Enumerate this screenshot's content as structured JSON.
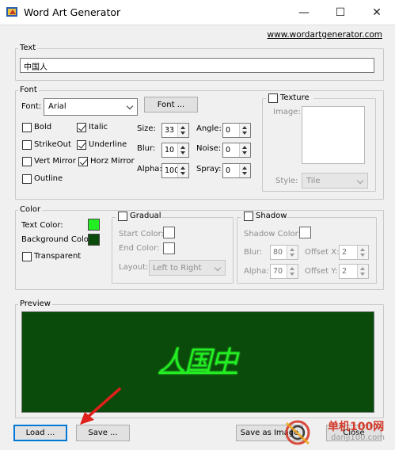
{
  "window": {
    "title": "Word Art Generator",
    "minimize_glyph": "—",
    "maximize_glyph": "☐",
    "close_glyph": "✕"
  },
  "website_link": "www.wordartgenerator.com",
  "text_group": {
    "label": "Text",
    "value": "中国人"
  },
  "font_group": {
    "label": "Font",
    "font_label": "Font:",
    "font_value": "Arial",
    "font_button": "Font ...",
    "checkboxes": {
      "bold": {
        "label": "Bold",
        "checked": false
      },
      "italic": {
        "label": "Italic",
        "checked": true
      },
      "strikeout": {
        "label": "StrikeOut",
        "checked": false
      },
      "underline": {
        "label": "Underline",
        "checked": true
      },
      "vert_mirror": {
        "label": "Vert Mirror",
        "checked": false
      },
      "horz_mirror": {
        "label": "Horz Mirror",
        "checked": true
      },
      "outline": {
        "label": "Outline",
        "checked": false
      }
    },
    "size": {
      "label": "Size:",
      "value": "33"
    },
    "blur": {
      "label": "Blur:",
      "value": "10"
    },
    "alpha": {
      "label": "Alpha:",
      "value": "100"
    },
    "angle": {
      "label": "Angle:",
      "value": "0"
    },
    "noise": {
      "label": "Noise:",
      "value": "0"
    },
    "spray": {
      "label": "Spray:",
      "value": "0"
    },
    "texture": {
      "label": "Texture",
      "checked": false,
      "image_label": "Image:",
      "style_label": "Style:",
      "style_value": "Tile"
    }
  },
  "color_group": {
    "label": "Color",
    "text_color_label": "Text Color:",
    "text_color": "#22ee22",
    "background_color_label": "Background Color",
    "background_color": "#0a4a0a",
    "transparent": {
      "label": "Transparent",
      "checked": false
    },
    "gradual": {
      "label": "Gradual",
      "checked": false,
      "start_label": "Start Color:",
      "end_label": "End Color:",
      "layout_label": "Layout:",
      "layout_value": "Left to Right"
    },
    "shadow": {
      "label": "Shadow",
      "checked": false,
      "shadow_color_label": "Shadow Color:",
      "blur_label": "Blur:",
      "blur_value": "80",
      "alpha_label": "Alpha:",
      "alpha_value": "70",
      "offset_x_label": "Offset X:",
      "offset_x_value": "2",
      "offset_y_label": "Offset Y:",
      "offset_y_value": "2"
    }
  },
  "preview_group": {
    "label": "Preview",
    "text": "人国中",
    "text_color": "#22ee22"
  },
  "buttons": {
    "load": "Load ...",
    "save": "Save ...",
    "save_as_image": "Save as Image",
    "close": "Close"
  },
  "watermark": {
    "site_name": "单机100网",
    "url": "danji100.com"
  }
}
